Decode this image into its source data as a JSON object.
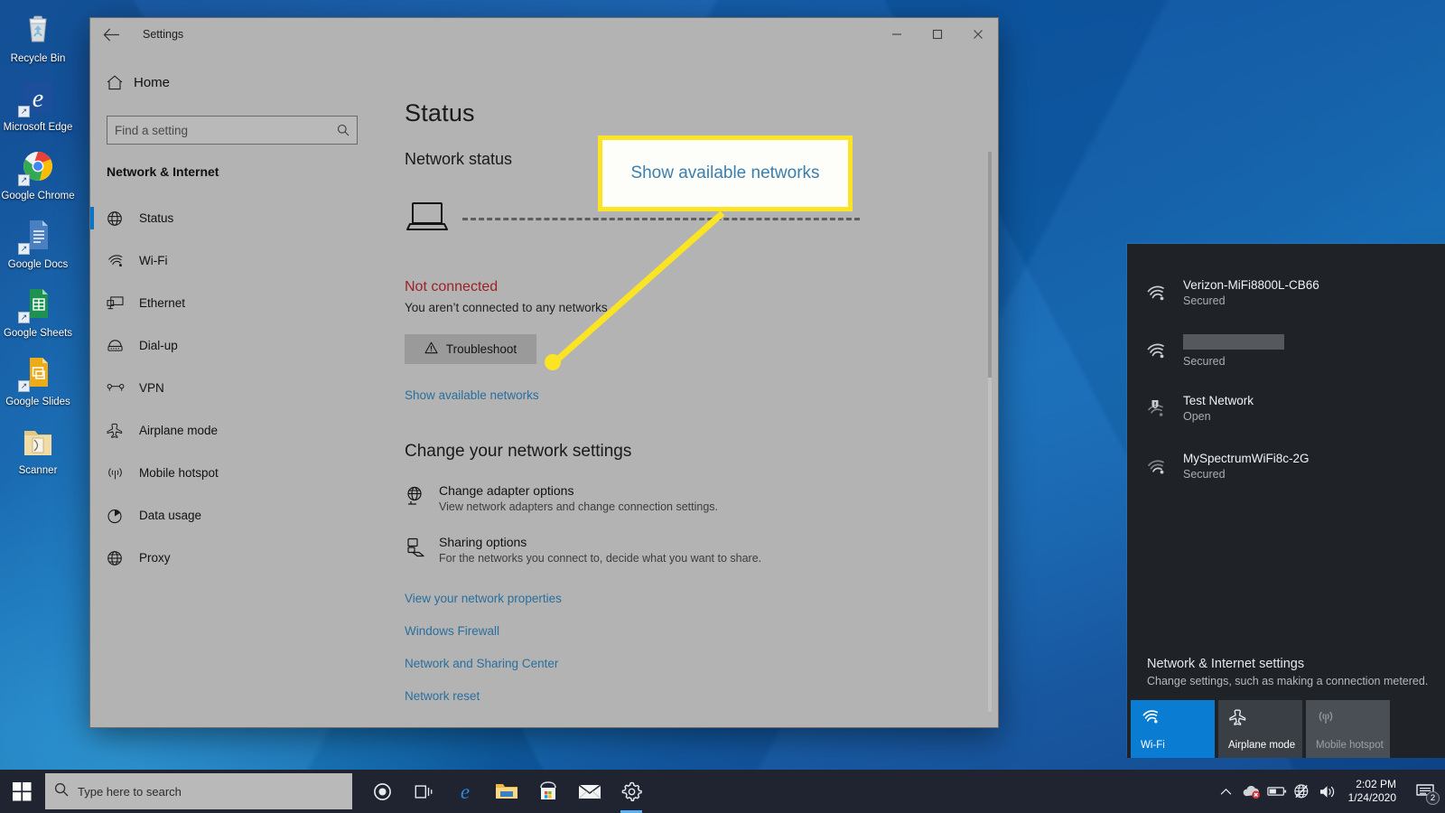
{
  "desktop": {
    "icons": [
      {
        "label": "Recycle Bin",
        "icon": "recycle-bin-icon",
        "shortcut": false
      },
      {
        "label": "Microsoft Edge",
        "icon": "edge-icon",
        "shortcut": true
      },
      {
        "label": "Google Chrome",
        "icon": "chrome-icon",
        "shortcut": true
      },
      {
        "label": "Google Docs",
        "icon": "google-docs-icon",
        "shortcut": true
      },
      {
        "label": "Google Sheets",
        "icon": "google-sheets-icon",
        "shortcut": true
      },
      {
        "label": "Google Slides",
        "icon": "google-slides-icon",
        "shortcut": true
      },
      {
        "label": "Scanner",
        "icon": "scanner-folder-icon",
        "shortcut": false
      }
    ]
  },
  "settings_window": {
    "title": "Settings",
    "back_icon": "back-arrow-icon",
    "controls": {
      "minimize": "–",
      "maximize": "☐",
      "close": "✕"
    },
    "sidebar": {
      "home_label": "Home",
      "home_icon": "home-icon",
      "search": {
        "placeholder": "Find a setting",
        "value": "",
        "icon": "search-icon"
      },
      "section_title": "Network & Internet",
      "items": [
        {
          "label": "Status",
          "icon": "globe-icon",
          "active": true
        },
        {
          "label": "Wi-Fi",
          "icon": "wifi-icon",
          "active": false
        },
        {
          "label": "Ethernet",
          "icon": "ethernet-icon",
          "active": false
        },
        {
          "label": "Dial-up",
          "icon": "dialup-icon",
          "active": false
        },
        {
          "label": "VPN",
          "icon": "vpn-icon",
          "active": false
        },
        {
          "label": "Airplane mode",
          "icon": "airplane-icon",
          "active": false
        },
        {
          "label": "Mobile hotspot",
          "icon": "hotspot-icon",
          "active": false
        },
        {
          "label": "Data usage",
          "icon": "data-usage-icon",
          "active": false
        },
        {
          "label": "Proxy",
          "icon": "proxy-globe-icon",
          "active": false
        }
      ]
    },
    "main": {
      "page_title": "Status",
      "network_status_heading": "Network status",
      "diagram": {
        "device_icon": "laptop-icon",
        "connection_style": "dashed"
      },
      "not_connected_title": "Not connected",
      "not_connected_desc": "You aren’t connected to any networks.",
      "troubleshoot_label": "Troubleshoot",
      "troubleshoot_icon": "warning-triangle-icon",
      "show_networks_link": "Show available networks",
      "change_settings_heading": "Change your network settings",
      "settings_rows": [
        {
          "title": "Change adapter options",
          "desc": "View network adapters and change connection settings.",
          "icon": "adapter-globe-icon"
        },
        {
          "title": "Sharing options",
          "desc": "For the networks you connect to, decide what you want to share.",
          "icon": "sharing-icon"
        }
      ],
      "links": [
        "View your network properties",
        "Windows Firewall",
        "Network and Sharing Center",
        "Network reset"
      ]
    }
  },
  "callout": {
    "text": "Show available networks",
    "border_color": "#fbe424",
    "text_color": "#3a7fae"
  },
  "network_flyout": {
    "networks": [
      {
        "name": "Verizon-MiFi8800L-CB66",
        "security": "Secured",
        "icon": "wifi-signal-icon",
        "redacted": false,
        "warning": false
      },
      {
        "name": "",
        "security": "Secured",
        "icon": "wifi-signal-icon",
        "redacted": true,
        "warning": false
      },
      {
        "name": "Test Network",
        "security": "Open",
        "icon": "wifi-warning-icon",
        "redacted": false,
        "warning": true
      },
      {
        "name": "MySpectrumWiFi8c-2G",
        "security": "Secured",
        "icon": "wifi-signal-weak-icon",
        "redacted": false,
        "warning": false
      }
    ],
    "settings_title": "Network & Internet settings",
    "settings_desc": "Change settings, such as making a connection metered.",
    "tiles": [
      {
        "label": "Wi-Fi",
        "icon": "wifi-icon",
        "state": "on"
      },
      {
        "label": "Airplane mode",
        "icon": "airplane-icon",
        "state": "off"
      },
      {
        "label": "Mobile hotspot",
        "icon": "hotspot-icon",
        "state": "disabled"
      }
    ]
  },
  "taskbar": {
    "start_icon": "windows-logo-icon",
    "search": {
      "placeholder": "Type here to search",
      "icon": "search-icon"
    },
    "icons": [
      {
        "name": "cortana-icon",
        "running": false
      },
      {
        "name": "task-view-icon",
        "running": false
      },
      {
        "name": "edge-icon",
        "running": false
      },
      {
        "name": "file-explorer-icon",
        "running": false
      },
      {
        "name": "microsoft-store-icon",
        "running": false
      },
      {
        "name": "mail-icon",
        "running": false
      },
      {
        "name": "settings-gear-icon",
        "running": true
      }
    ],
    "tray": [
      {
        "name": "show-hidden-icons-chevron-icon"
      },
      {
        "name": "onedrive-error-icon"
      },
      {
        "name": "battery-icon"
      },
      {
        "name": "network-disconnected-globe-icon"
      },
      {
        "name": "volume-icon"
      }
    ],
    "clock": {
      "time": "2:02 PM",
      "date": "1/24/2020"
    },
    "action_center": {
      "icon": "action-center-icon",
      "badge": "2"
    }
  }
}
